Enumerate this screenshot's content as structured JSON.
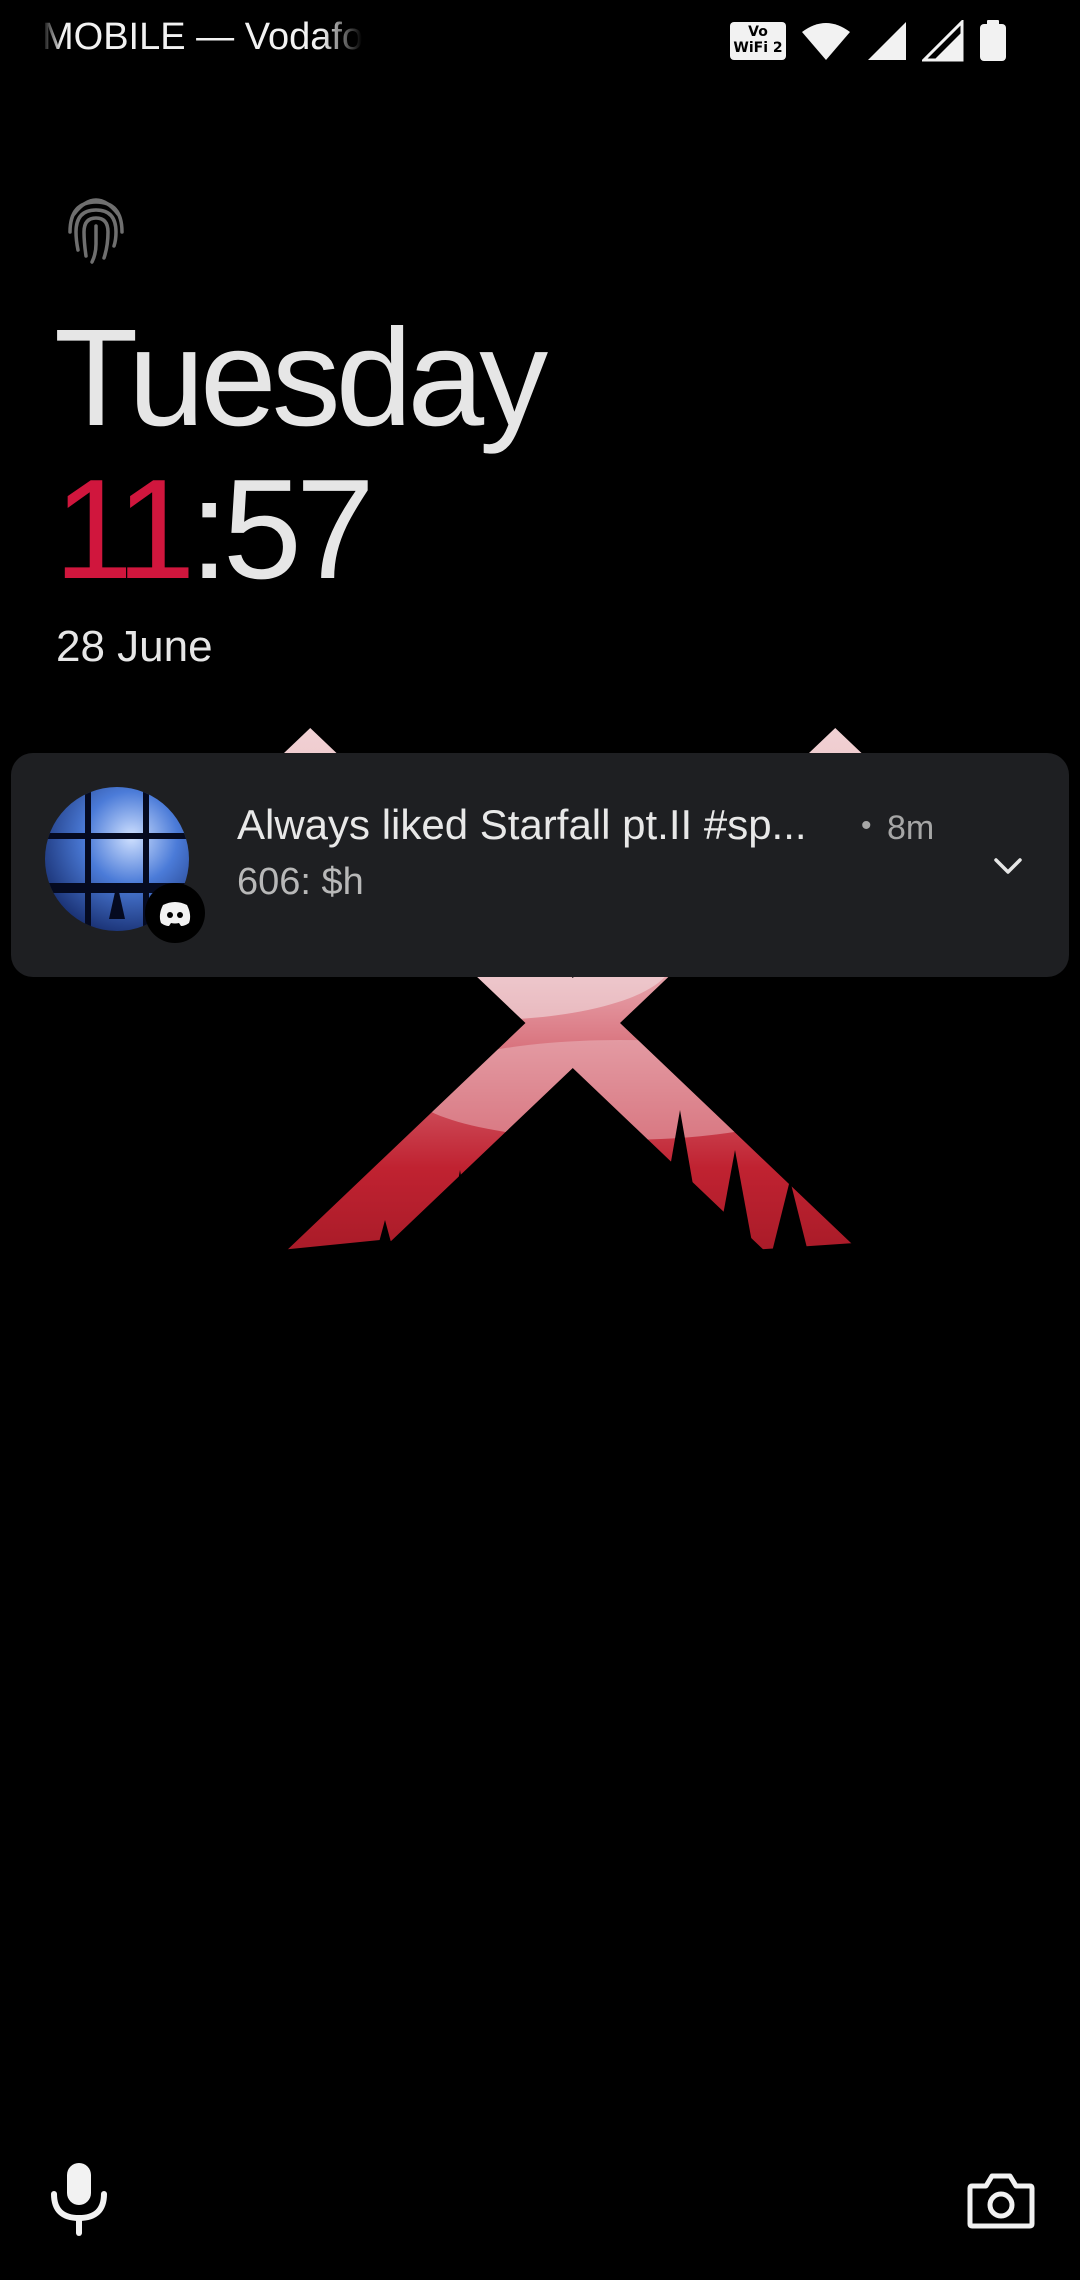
{
  "status_bar": {
    "carrier": "MOBILE — Vodafor",
    "vowifi_line1": "Vo",
    "vowifi_line2": "WiFi 2"
  },
  "lockscreen": {
    "day": "Tuesday",
    "time_hour": "11",
    "time_separator": ":",
    "time_minute": "57",
    "date": "28 June"
  },
  "notification": {
    "title": "Always liked Starfall pt.II #sp...",
    "dot": "•",
    "time": "8m",
    "body": "606: $h",
    "app_icon": "discord-icon"
  },
  "shortcuts": {
    "left": "mic-icon",
    "right": "camera-icon"
  },
  "colors": {
    "accent": "#d0163d",
    "background": "#000000",
    "notification_bg": "#1e1f22"
  }
}
